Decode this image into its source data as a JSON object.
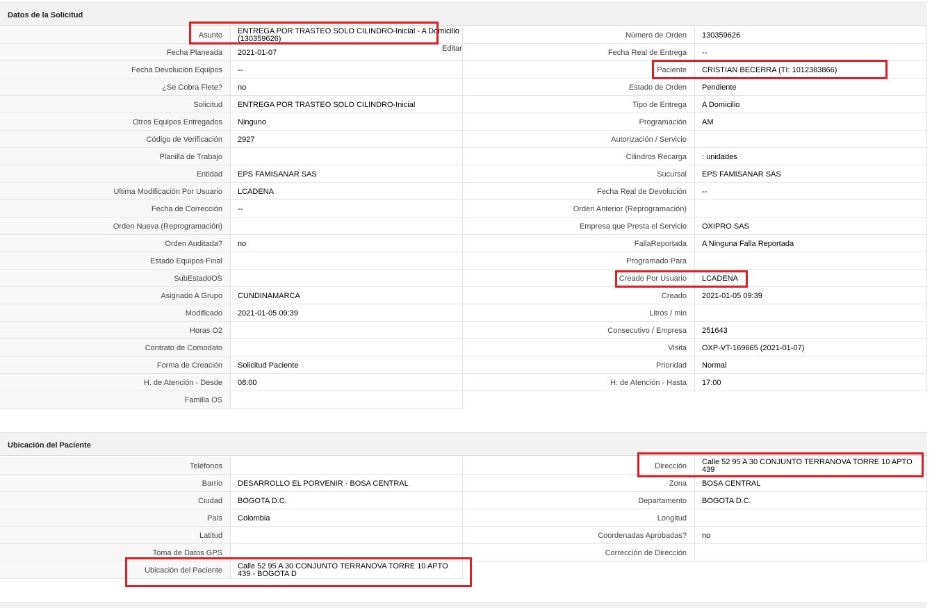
{
  "solicitud": {
    "title": "Datos de la Solicitud",
    "edit_label": "Editar",
    "left": [
      {
        "label": "Asunto",
        "value": "ENTREGA POR TRASTEO SOLO CILINDRO-Inicial - A Domicilio (130359626)"
      },
      {
        "label": "Fecha Planeada",
        "value": "2021-01-07"
      },
      {
        "label": "Fecha Devolución Equipos",
        "value": "--"
      },
      {
        "label": "¿Se Cobra Flete?",
        "value": "no"
      },
      {
        "label": "Solicitud",
        "value": "ENTREGA POR TRASTEO SOLO CILINDRO-Inicial"
      },
      {
        "label": "Otros Equipos Entregados",
        "value": "Ninguno"
      },
      {
        "label": "Código de Verificación",
        "value": "2927"
      },
      {
        "label": "Planilla de Trabajo",
        "value": ""
      },
      {
        "label": "Entidad",
        "value": "EPS FAMISANAR SAS"
      },
      {
        "label": "Ultima Modificación Por Usuario",
        "value": "LCADENA"
      },
      {
        "label": "Fecha de Corrección",
        "value": "--"
      },
      {
        "label": "Orden Nueva (Reprogramación)",
        "value": ""
      },
      {
        "label": "Orden Auditada?",
        "value": "no"
      },
      {
        "label": "Estado Equipos Final",
        "value": ""
      },
      {
        "label": "SubEstadoOS",
        "value": ""
      },
      {
        "label": "Asignado A Grupo",
        "value": "CUNDINAMARCA"
      },
      {
        "label": "Modificado",
        "value": "2021-01-05 09:39"
      },
      {
        "label": "Horas O2",
        "value": ""
      },
      {
        "label": "Contrato de Comodato",
        "value": ""
      },
      {
        "label": "Forma de Creación",
        "value": "Solicitud Paciente"
      },
      {
        "label": "H. de Atención - Desde",
        "value": "08:00"
      },
      {
        "label": "Familia OS",
        "value": ""
      }
    ],
    "right": [
      {
        "label": "Número de Orden",
        "value": "130359626"
      },
      {
        "label": "Fecha Real de Entrega",
        "value": "--"
      },
      {
        "label": "Paciente",
        "value": "CRISTIAN BECERRA (TI: 1012383866)"
      },
      {
        "label": "Estado de Orden",
        "value": "Pendiente"
      },
      {
        "label": "Tipo de Entrega",
        "value": "A Domicilio"
      },
      {
        "label": "Programación",
        "value": "AM"
      },
      {
        "label": "Autorización / Servicio",
        "value": ""
      },
      {
        "label": "Cilindros Recarga",
        "value": ": unidades"
      },
      {
        "label": "Sucursal",
        "value": "EPS FAMISANAR SAS"
      },
      {
        "label": "Fecha Real de Devolución",
        "value": "--"
      },
      {
        "label": "Orden Anterior (Reprogramación)",
        "value": ""
      },
      {
        "label": "Empresa que Presta el Servicio",
        "value": "OXIPRO SAS"
      },
      {
        "label": "FallaReportada",
        "value": "A Ninguna Falla Reportada"
      },
      {
        "label": "Programado Para",
        "value": ""
      },
      {
        "label": "Creado Por Usuario",
        "value": "LCADENA"
      },
      {
        "label": "Creado",
        "value": "2021-01-05 09:39"
      },
      {
        "label": "Litros / min",
        "value": ""
      },
      {
        "label": "Consecutivo / Empresa",
        "value": "251643"
      },
      {
        "label": "Visita",
        "value": "OXP-VT-169665 (2021-01-07)"
      },
      {
        "label": "Prioridad",
        "value": "Normal"
      },
      {
        "label": "H. de Atención - Hasta",
        "value": "17:00"
      }
    ]
  },
  "ubicacion": {
    "title": "Ubicación del Paciente",
    "left": [
      {
        "label": "Teléfonos",
        "value": ""
      },
      {
        "label": "Barrio",
        "value": "DESARROLLO EL PORVENIR - BOSA CENTRAL"
      },
      {
        "label": "Ciudad",
        "value": "BOGOTA D.C."
      },
      {
        "label": "País",
        "value": "Colombia"
      },
      {
        "label": "Latitud",
        "value": ""
      },
      {
        "label": "Toma de Datos GPS",
        "value": ""
      },
      {
        "label": "Ubicación del Paciente",
        "value": "Calle 52 95 A 30 CONJUNTO TERRANOVA TORRE 10 APTO 439 - BOGOTA D"
      }
    ],
    "right": [
      {
        "label": "Dirección",
        "value": "Calle 52 95 A 30 CONJUNTO TERRANOVA TORRE 10 APTO 439"
      },
      {
        "label": "Zona",
        "value": "BOSA CENTRAL"
      },
      {
        "label": "Departamento",
        "value": "BOGOTA D.C."
      },
      {
        "label": "Longitud",
        "value": ""
      },
      {
        "label": "Coordenadas Aprobadas?",
        "value": "no"
      },
      {
        "label": "Corrección de Dirección",
        "value": ""
      }
    ]
  },
  "highlight_color": "#e01e26"
}
